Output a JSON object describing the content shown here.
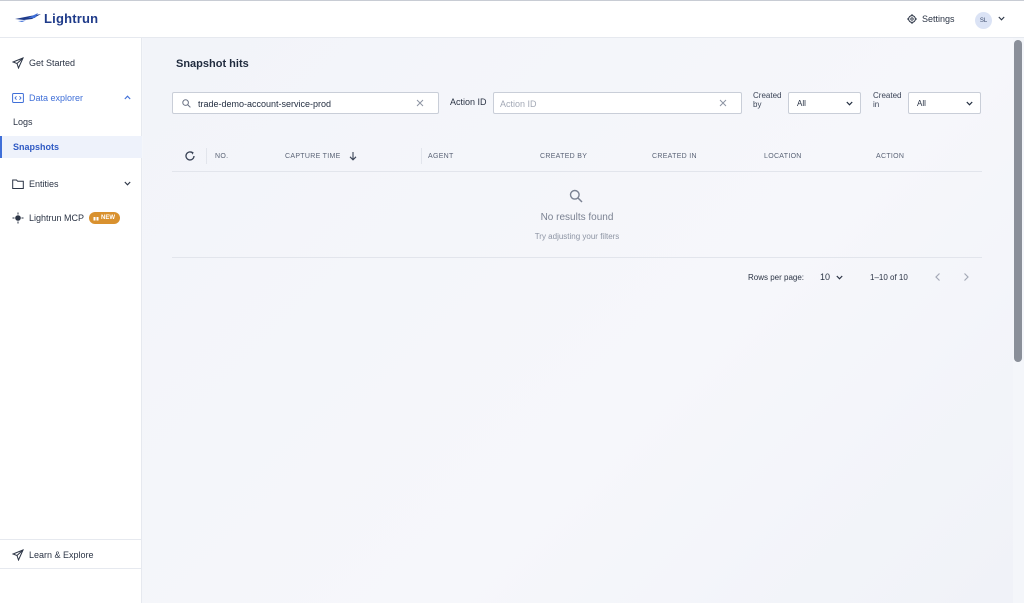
{
  "brand": {
    "name": "Lightrun"
  },
  "header": {
    "settings_label": "Settings",
    "avatar_initials": "SL"
  },
  "sidebar": {
    "items": [
      {
        "label": "Get Started",
        "icon": "rocket-icon"
      },
      {
        "label": "Data explorer",
        "icon": "code-icon",
        "expanded": true,
        "children": [
          {
            "label": "Logs"
          },
          {
            "label": "Snapshots",
            "active": true
          }
        ]
      },
      {
        "label": "Entities",
        "icon": "folder-icon",
        "expanded": false
      },
      {
        "label": "Lightrun MCP",
        "icon": "mcp-icon",
        "badge": "NEW"
      }
    ],
    "bottom": {
      "label": "Learn & Explore",
      "icon": "rocket-icon"
    }
  },
  "main": {
    "title": "Snapshot hits",
    "search": {
      "value": "trade-demo-account-service-prod"
    },
    "action_id": {
      "label": "Action ID",
      "placeholder": "Action ID"
    },
    "created_by": {
      "label": "Created by",
      "value": "All"
    },
    "created_in": {
      "label": "Created in",
      "value": "All"
    },
    "table": {
      "columns": [
        "NO.",
        "CAPTURE TIME",
        "AGENT",
        "CREATED BY",
        "CREATED IN",
        "LOCATION",
        "ACTION"
      ],
      "empty_title": "No results found",
      "empty_subtitle": "Try adjusting your filters"
    },
    "pagination": {
      "rows_per_page_label": "Rows per page:",
      "rows_per_page": "10",
      "range": "1–10 of 10"
    }
  },
  "colors": {
    "accent": "#3f6fd8",
    "brand": "#1f3b8a",
    "badge": "#d9912e"
  }
}
